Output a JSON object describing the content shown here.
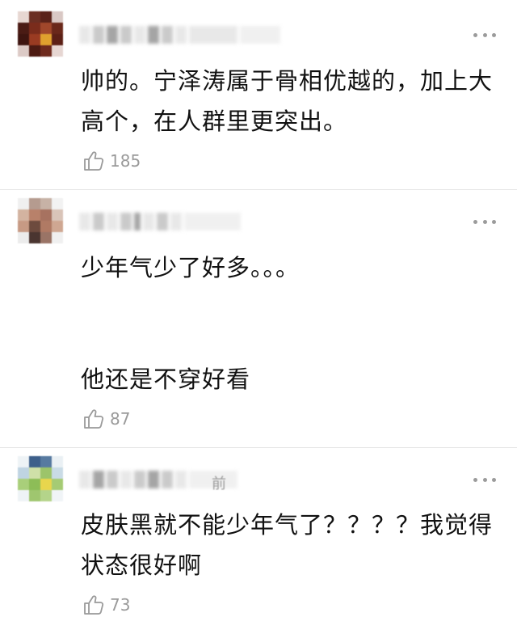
{
  "comments": [
    {
      "text": "帅的。宁泽涛属于骨相优越的，加上大高个，在人群里更突出。",
      "likes": "185",
      "time_tail": ""
    },
    {
      "text_line1": "少年气少了好多。。。",
      "text_line2": "他还是不穿好看",
      "likes": "87",
      "time_tail": ""
    },
    {
      "text": "皮肤黑就不能少年气了？？？？我觉得状态很好啊",
      "likes": "73",
      "time_tail": "前"
    }
  ],
  "icons": {
    "more": "more-dots-icon",
    "like": "thumbs-up-icon"
  },
  "colors": {
    "text": "#111111",
    "meta": "#9a9a9a",
    "divider": "#e6e6e6"
  }
}
